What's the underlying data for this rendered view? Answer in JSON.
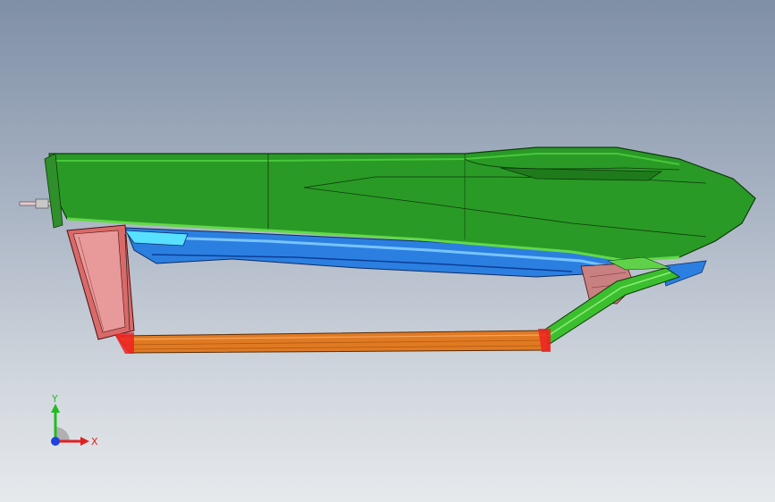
{
  "viewport": {
    "background_top": "#7f8fa6",
    "background_bottom": "#e6e9ec"
  },
  "model": {
    "parts": [
      {
        "name": "upper-shell",
        "color": "#2a9a26"
      },
      {
        "name": "rear-bracket",
        "color": "#d96a6a"
      },
      {
        "name": "inner-frame",
        "color": "#1f6fd6"
      },
      {
        "name": "lower-rail",
        "color": "#e07a22"
      },
      {
        "name": "diagonal-strut",
        "color": "#3cbf2e"
      },
      {
        "name": "front-mount",
        "color": "#d97a7a"
      }
    ]
  },
  "triad": {
    "x_label": "X",
    "y_label": "Y",
    "x_color": "#e02020",
    "y_color": "#22bb22",
    "z_color": "#2040e0"
  }
}
